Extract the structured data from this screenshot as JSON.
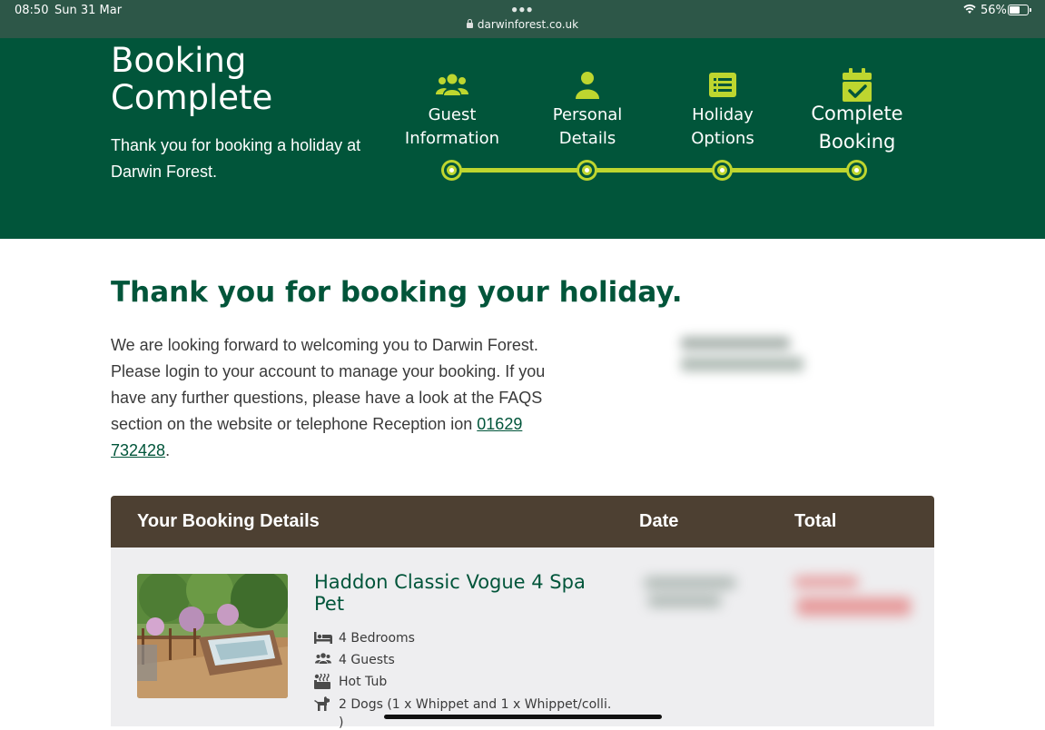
{
  "status_bar": {
    "time": "08:50",
    "date": "Sun 31 Mar",
    "url": "darwinforest.co.uk",
    "battery_percent": "56%",
    "battery_level": 0.56
  },
  "hero": {
    "title_line1": "Booking",
    "title_line2": "Complete",
    "subtitle": "Thank you for booking a holiday at Darwin Forest."
  },
  "steps": [
    {
      "line1": "Guest",
      "line2": "Information",
      "icon": "users-icon"
    },
    {
      "line1": "Personal",
      "line2": "Details",
      "icon": "user-icon"
    },
    {
      "line1": "Holiday",
      "line2": "Options",
      "icon": "list-icon"
    },
    {
      "line1": "Complete",
      "line2": "Booking",
      "icon": "calendar-check-icon"
    }
  ],
  "intro": {
    "heading": "Thank you for booking your holiday.",
    "text_before_phone": "We are looking forward to welcoming you to Darwin Forest. Please login to your account to manage your booking. If you have any further questions, please have a look at the FAQS section on the website or telephone Reception ion ",
    "phone": "01629 732428",
    "text_after_phone": "."
  },
  "booking": {
    "header_details": "Your Booking Details",
    "header_date": "Date",
    "header_total": "Total",
    "lodge_name": "Haddon Classic Vogue 4 Spa Pet",
    "features": [
      {
        "icon": "bed-icon",
        "text": "4 Bedrooms"
      },
      {
        "icon": "guests-icon",
        "text": "4 Guests"
      },
      {
        "icon": "hot-tub-icon",
        "text": "Hot Tub"
      },
      {
        "icon": "dog-icon",
        "text": "2 Dogs (1 x Whippet and 1 x Whippet/colli."
      }
    ],
    "feature_continuation": ")"
  },
  "colors": {
    "brand_green": "#01553a",
    "accent_lime": "#bed62f",
    "table_header_brown": "#4d4032",
    "table_body_grey": "#eeeef0"
  }
}
